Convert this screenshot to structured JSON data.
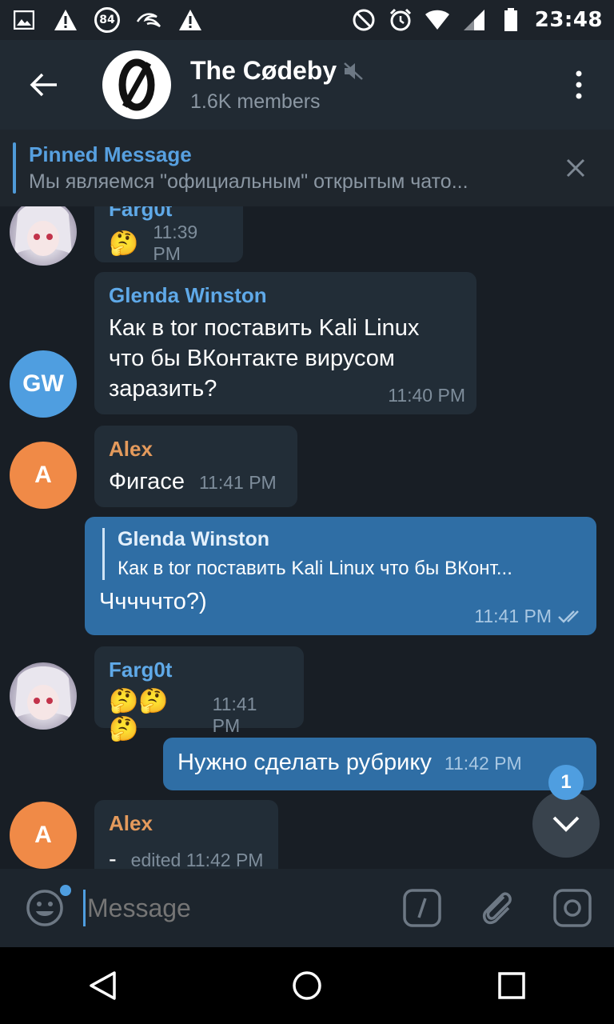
{
  "status_bar": {
    "battery_badge": "84",
    "time": "23:48"
  },
  "header": {
    "title": "The Cødeby",
    "subtitle": "1.6K members"
  },
  "pinned": {
    "title": "Pinned Message",
    "text": "Мы являемся \"официальным\" открытым чато..."
  },
  "messages": [
    {
      "sender": "Farg0t",
      "text": "🤔",
      "time": "11:39 PM"
    },
    {
      "sender": "Glenda Winston",
      "avatar_initials": "GW",
      "text": "Как в tor поставить Kali Linux что бы ВКонтакте вирусом заразить?",
      "time": "11:40 PM"
    },
    {
      "sender": "Alex",
      "avatar_initials": "A",
      "text": "Фигасе",
      "time": "11:41 PM"
    },
    {
      "reply_name": "Glenda Winston",
      "reply_text": "Как в tor поставить Kali Linux что бы ВКонт...",
      "text": "Чччччто?)",
      "time": "11:41 PM"
    },
    {
      "sender": "Farg0t",
      "text": "🤔🤔🤔",
      "time": "11:41 PM"
    },
    {
      "text": "Нужно сделать рубрику",
      "time": "11:42 PM"
    },
    {
      "sender": "Alex",
      "avatar_initials": "A",
      "text": "-",
      "time": "edited 11:42 PM"
    }
  ],
  "fab": {
    "unread_count": "1"
  },
  "input": {
    "placeholder": "Message"
  },
  "colors": {
    "accent": "#4f9ee0",
    "outgoing_bubble": "#2f6ea5",
    "incoming_bubble": "#222d37",
    "alex": "#f08a47"
  }
}
